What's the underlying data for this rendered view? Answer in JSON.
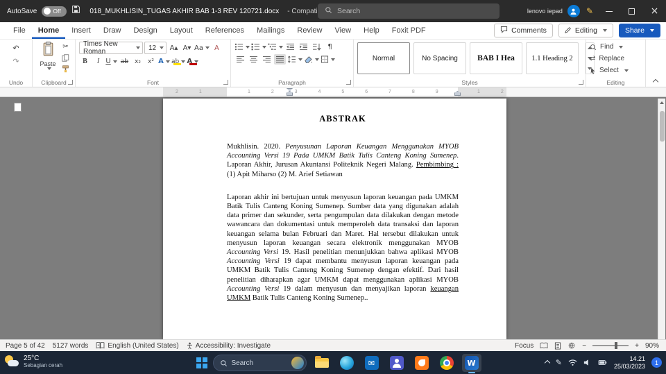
{
  "titlebar": {
    "autosave_label": "AutoSave",
    "autosave_state": "Off",
    "doc_title": "018_MUKHLISIN_TUGAS AKHIR BAB 1-3 REV 120721.docx",
    "compatibility": "- Compatibility Mode",
    "search_placeholder": "Search",
    "user_name": "lenovo iepad"
  },
  "tabs": {
    "items": [
      "File",
      "Home",
      "Insert",
      "Draw",
      "Design",
      "Layout",
      "References",
      "Mailings",
      "Review",
      "View",
      "Help",
      "Foxit PDF"
    ],
    "active": "Home",
    "comments": "Comments",
    "editing": "Editing",
    "share": "Share"
  },
  "ribbon": {
    "undo_group": "Undo",
    "paste": "Paste",
    "clipboard_group": "Clipboard",
    "font_name": "Times New Roman",
    "font_size": "12",
    "font_group": "Font",
    "paragraph_group": "Paragraph",
    "styles": [
      "Normal",
      "No Spacing",
      "BAB I Hea",
      "1.1 Heading 2"
    ],
    "styles_group": "Styles",
    "find": "Find",
    "replace": "Replace",
    "select": "Select",
    "editing_group": "Editing"
  },
  "icons": {
    "undo": "↶",
    "redo": "↷",
    "cut": "✂",
    "pilcrow": "¶",
    "bold": "B",
    "italic": "I",
    "underline": "U",
    "strikethrough": "ab",
    "subscript": "x₂",
    "superscript": "x²",
    "grow_font": "A▴",
    "shrink_font": "A▾",
    "change_case": "Aa",
    "clear_format": "A",
    "text_effects": "A",
    "font_color": "A",
    "highlight": "ab",
    "replace_glyph": "⇄",
    "mail": "✉",
    "word_letter": "W",
    "pen": "✎",
    "zoom_out": "−",
    "zoom_in": "+"
  },
  "ruler": {
    "left_numbers": "2 1",
    "center_numbers": "1 2 3 4 5 6 7 8 9",
    "right_numbers": "1 2"
  },
  "document": {
    "heading": "ABSTRAK",
    "p1": {
      "s1": "Mukhlisin. 2020. ",
      "s2": "Penyusunan Laporan Keuangan Menggunakan MYOB Accounting Versi 19 Pada UMKM Batik Tulis Canteng Koning Sumenep",
      "s3": ". Laporan Akhir, Jurusan Akuntansi Politeknik Negeri Malang. ",
      "s4": "Pembimbing :",
      "s5": " (1) Apit Miharso  (2) M. Arief Setiawan"
    },
    "p2": {
      "s1": "Laporan akhir ini bertujuan untuk menyusun laporan keuangan pada UMKM Batik Tulis Canteng Koning Sumenep. Sumber data yang digunakan adalah data primer dan sekunder, serta pengumpulan data dilakukan dengan metode wawancara dan dokumentasi untuk memperoleh data transaksi dan laporan keuangan selama bulan Februari dan Maret. Hal tersebut dilakukan untuk menyusun laporan keuangan secara elektronik menggunakan MYOB ",
      "s2": "Accounting Versi",
      "s3": " 19. Hasil penelitian menunjukkan bahwa aplikasi MYOB ",
      "s4": "Accounting Versi",
      "s5": " 19 dapat membantu menyusun laporan keuangan pada UMKM Batik Tulis Canteng Koning Sumenep dengan efektif. Dari hasil penelitian diharapkan agar UMKM dapat menggunakan aplikasi MYOB ",
      "s6": "Accounting Versi",
      "s7": " 19 dalam menyusun dan menyajikan laporan ",
      "s8": "keuangan UMKM",
      "s9": " Batik Tulis Canteng Koning Sumenep.."
    }
  },
  "statusbar": {
    "page_info": "Page 5 of 42",
    "words": "5127 words",
    "language": "English (United States)",
    "accessibility": "Accessibility: Investigate",
    "focus": "Focus",
    "zoom": "90%"
  },
  "taskbar": {
    "temp": "25°C",
    "weather": "Sebagian cerah",
    "search": "Search",
    "time": "14.21",
    "date": "25/03/2023",
    "badge": "1"
  },
  "colors": {
    "accent_blue": "#185abd",
    "titlebar_bg": "#2b2b2b",
    "document_bg": "#7d7d7d",
    "taskbar_bg": "#1b2636",
    "font_color_red": "#c00000",
    "highlight_yellow": "#ffe000"
  }
}
